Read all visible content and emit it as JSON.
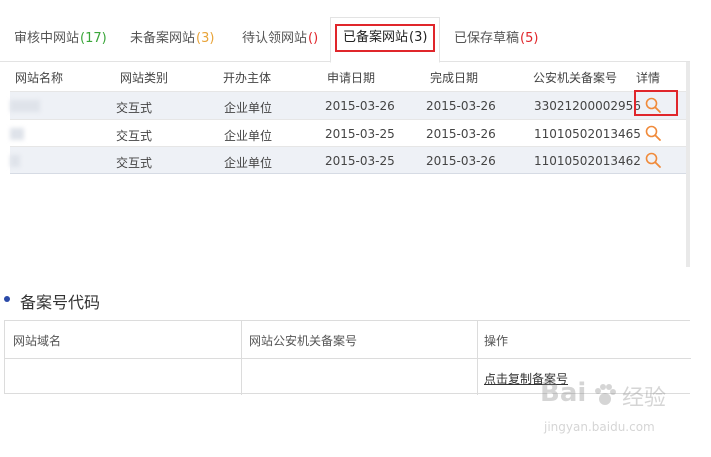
{
  "tabs": [
    {
      "label": "审核中网站",
      "count": "(17)",
      "count_color": "#3aa63a"
    },
    {
      "label": "未备案网站",
      "count": "(3)",
      "count_color": "#e8a43a"
    },
    {
      "label": "待认领网站",
      "count": "()",
      "count_color": "#e0262b"
    },
    {
      "label": "已备案网站",
      "count": "(3)",
      "count_color": "#222222"
    },
    {
      "label": "已保存草稿",
      "count": "(5)",
      "count_color": "#e0262b"
    }
  ],
  "table": {
    "headers": [
      "网站名称",
      "网站类别",
      "开办主体",
      "申请日期",
      "完成日期",
      "公安机关备案号",
      "详情"
    ],
    "rows": [
      {
        "name": "",
        "category": "交互式",
        "owner": "企业单位",
        "apply_date": "2015-03-26",
        "finish_date": "2015-03-26",
        "record_no": "33021200002956",
        "detail_icon": "search-icon"
      },
      {
        "name": "",
        "category": "交互式",
        "owner": "企业单位",
        "apply_date": "2015-03-25",
        "finish_date": "2015-03-26",
        "record_no": "11010502013465",
        "detail_icon": "search-icon"
      },
      {
        "name": "",
        "category": "交互式",
        "owner": "企业单位",
        "apply_date": "2015-03-25",
        "finish_date": "2015-03-26",
        "record_no": "11010502013462",
        "detail_icon": "search-icon"
      }
    ]
  },
  "section": {
    "title": "备案号代码",
    "headers": [
      "网站域名",
      "网站公安机关备案号",
      "操作"
    ],
    "action_link": "点击复制备案号"
  },
  "watermark": {
    "brand": "Bai",
    "brand2": "经验",
    "url": "jingyan.baidu.com"
  },
  "colors": {
    "highlight": "#e0262b",
    "icon": "#f08a3a",
    "row_alt": "#eef1f6",
    "bullet": "#2b4aa8"
  }
}
